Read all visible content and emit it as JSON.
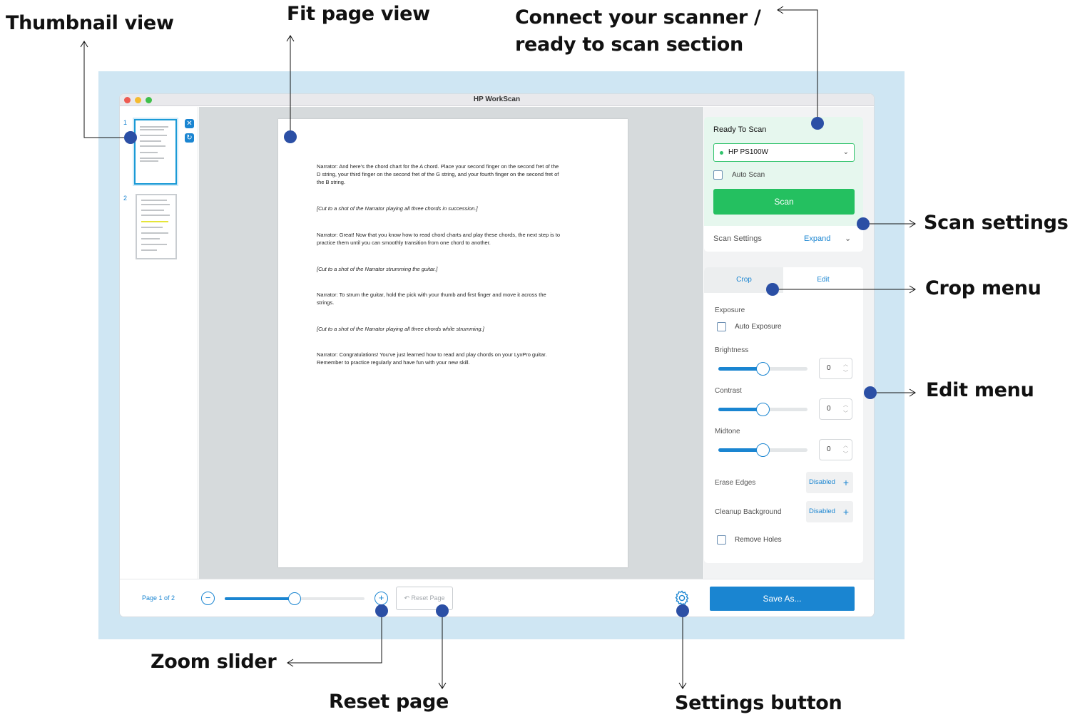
{
  "callouts": {
    "thumbnail_view": "Thumbnail view",
    "fit_page_view": "Fit page view",
    "connect_scanner_line1": "Connect your scanner /",
    "connect_scanner_line2": "ready to scan section",
    "scan_settings": "Scan settings",
    "crop_menu": "Crop menu",
    "edit_menu": "Edit menu",
    "zoom_slider": "Zoom slider",
    "reset_page": "Reset page",
    "settings_button": "Settings button"
  },
  "window": {
    "title": "HP WorkScan"
  },
  "thumbnails": {
    "items": [
      {
        "number": "1",
        "selected": true
      },
      {
        "number": "2",
        "selected": false
      }
    ],
    "delete_icon": "close-icon",
    "rotate_icon": "rotate-icon"
  },
  "document": {
    "paragraphs": [
      "Narrator: And here’s the chord chart for the A chord. Place your second finger on the second fret of the",
      "D string, your third finger on the second fret of the G string, and your fourth finger on the second fret of",
      "the B string.",
      "[Cut to a shot of the Narrator playing all three chords in succession.]",
      "Narrator: Great! Now that you know how to read chord charts and play these chords, the next step is to",
      "practice them until you can smoothly transition from one chord to another.",
      "[Cut to a shot of the Narrator strumming the guitar.]",
      "Narrator: To strum the guitar, hold the pick with your thumb and first finger and move it across the",
      "strings.",
      "[Cut to a shot of the Narrator playing all three chords while strumming.]",
      "Narrator: Congratulations! You’ve just learned how to read and play chords on your LyxPro guitar.",
      "Remember to practice regularly and have fun with your new skill."
    ]
  },
  "scan": {
    "status": "Ready To Scan",
    "scanner": "HP PS100W",
    "auto_scan_label": "Auto Scan",
    "scan_button": "Scan",
    "settings_label": "Scan Settings",
    "expand_label": "Expand"
  },
  "edit": {
    "tabs": {
      "crop": "Crop",
      "edit": "Edit"
    },
    "exposure_label": "Exposure",
    "auto_exposure_label": "Auto Exposure",
    "brightness": {
      "label": "Brightness",
      "value": "0",
      "level": 0.5
    },
    "contrast": {
      "label": "Contrast",
      "value": "0",
      "level": 0.5
    },
    "midtone": {
      "label": "Midtone",
      "value": "0",
      "level": 0.5
    },
    "erase_edges": {
      "label": "Erase Edges",
      "state": "Disabled"
    },
    "cleanup_background": {
      "label": "Cleanup Background",
      "state": "Disabled"
    },
    "remove_holes_label": "Remove Holes"
  },
  "bottom": {
    "page_label": "Page 1 of 2",
    "zoom_minus": "−",
    "zoom_plus": "+",
    "zoom_level": 0.5,
    "reset_label": "Reset Page",
    "reset_icon": "undo-icon",
    "settings_icon": "gear-icon",
    "save_label": "Save As..."
  },
  "colors": {
    "accent_blue": "#1a85d1",
    "scan_green": "#24c060",
    "callout_dot": "#2b4fa5",
    "frame": "#cfe6f3"
  }
}
